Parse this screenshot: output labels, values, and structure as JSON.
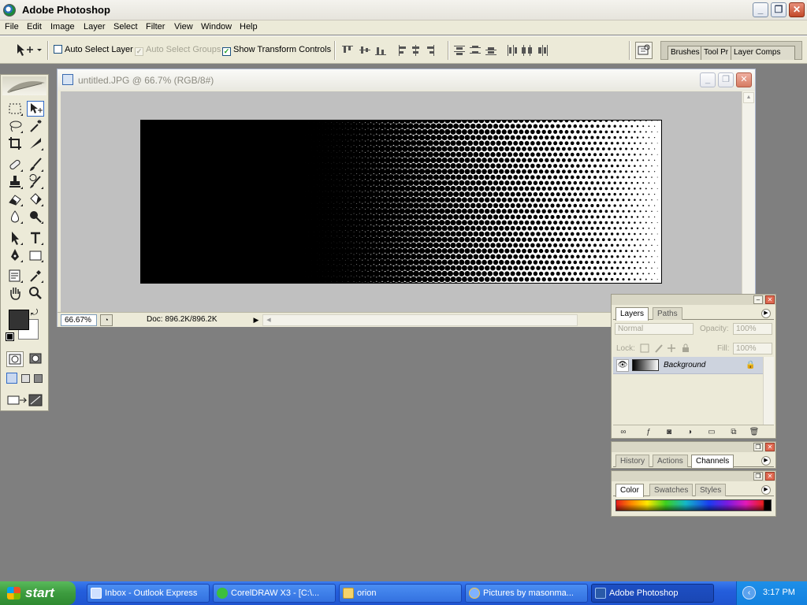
{
  "app": {
    "title": "Adobe Photoshop"
  },
  "window_controls": {
    "minimize": "_",
    "restore": "❐",
    "close": "✕"
  },
  "menu": [
    "File",
    "Edit",
    "Image",
    "Layer",
    "Select",
    "Filter",
    "View",
    "Window",
    "Help"
  ],
  "options_bar": {
    "auto_select_layer": {
      "label": "Auto Select Layer",
      "checked": false
    },
    "auto_select_groups": {
      "label": "Auto Select Groups",
      "checked": true,
      "disabled": true
    },
    "show_transform_controls": {
      "label": "Show Transform Controls",
      "checked": true
    },
    "palette_well_tabs": [
      "Brushes",
      "Tool Pr",
      "Layer Comps"
    ]
  },
  "document": {
    "title": "untitled.JPG @ 66.7% (RGB/8#)",
    "zoom": "66.67%",
    "doc_info": "Doc: 896.2K/896.2K",
    "content": "halftone dot gradient, black on the left fading to white on the right"
  },
  "layers_palette": {
    "tabs": [
      "Layers",
      "Paths"
    ],
    "active_tab": "Layers",
    "blend_mode": "Normal",
    "opacity_label": "Opacity:",
    "opacity": "100%",
    "lock_label": "Lock:",
    "fill_label": "Fill:",
    "fill": "100%",
    "layers": [
      {
        "name": "Background",
        "visible": true,
        "locked": true
      }
    ]
  },
  "history_palette": {
    "tabs": [
      "History",
      "Actions",
      "Channels"
    ],
    "active_tab": "Channels"
  },
  "color_palette": {
    "tabs": [
      "Color",
      "Swatches",
      "Styles"
    ],
    "active_tab": "Color"
  },
  "colors": {
    "foreground": "#333333",
    "background": "#ffffff",
    "desktop": "#7f7f7f",
    "taskbar": "#245edc",
    "start": "#3c9b3e"
  },
  "taskbar": {
    "start_label": "start",
    "tasks": [
      {
        "label": "Inbox - Outlook Express",
        "icon": "outlook-icon",
        "active": false
      },
      {
        "label": "CorelDRAW X3 - [C:\\...",
        "icon": "coreldraw-icon",
        "active": false
      },
      {
        "label": "orion",
        "icon": "folder-icon",
        "active": false
      },
      {
        "label": "Pictures by masonma...",
        "icon": "internet-explorer-icon",
        "active": false
      },
      {
        "label": "Adobe Photoshop",
        "icon": "photoshop-icon",
        "active": true
      }
    ],
    "clock": "3:17 PM"
  }
}
